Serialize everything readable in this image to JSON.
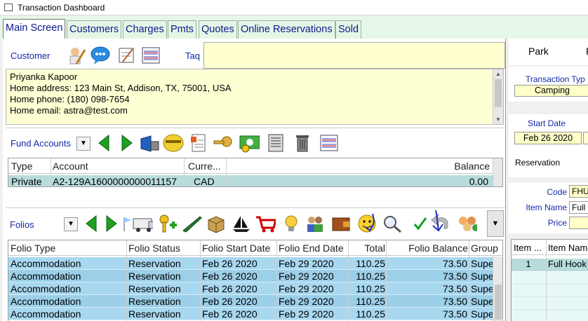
{
  "window": {
    "title": "Transaction Dashboard"
  },
  "tabs": [
    {
      "label": "Main Screen",
      "active": true
    },
    {
      "label": "Customers"
    },
    {
      "label": "Charges"
    },
    {
      "label": "Pmts"
    },
    {
      "label": "Quotes"
    },
    {
      "label": "Online Reservations"
    },
    {
      "label": "Sold"
    }
  ],
  "customer": {
    "label": "Customer",
    "tag_label": "Taq",
    "tag_value": "",
    "lines": [
      "Priyanka Kapoor",
      "Home address: 123 Main St, Addison, TX, 75001, USA",
      "Home phone: (180) 098-7654",
      "Home email: astra@test.com"
    ]
  },
  "fund_accounts": {
    "label": "Fund Accounts",
    "columns": [
      "Type",
      "Account",
      "Curre...",
      "Balance"
    ],
    "rows": [
      {
        "type": "Private",
        "account": "A2-129A1600000000011157",
        "currency": "CAD",
        "balance": "0.00"
      }
    ]
  },
  "folios": {
    "label": "Folios",
    "columns": [
      "Folio Type",
      "Folio Status",
      "Folio Start Date",
      "Folio End Date",
      "Total",
      "Folio Balance",
      "Group"
    ],
    "rows": [
      {
        "type": "Accommodation",
        "status": "Reservation",
        "start": "Feb 26 2020",
        "end": "Feb 29 2020",
        "total": "110.25",
        "balance": "73.50",
        "group": "Supe"
      },
      {
        "type": "Accommodation",
        "status": "Reservation",
        "start": "Feb 26 2020",
        "end": "Feb 29 2020",
        "total": "110.25",
        "balance": "73.50",
        "group": "Supe"
      },
      {
        "type": "Accommodation",
        "status": "Reservation",
        "start": "Feb 26 2020",
        "end": "Feb 29 2020",
        "total": "110.25",
        "balance": "73.50",
        "group": "Supe"
      },
      {
        "type": "Accommodation",
        "status": "Reservation",
        "start": "Feb 26 2020",
        "end": "Feb 29 2020",
        "total": "110.25",
        "balance": "73.50",
        "group": "Supe"
      },
      {
        "type": "Accommodation",
        "status": "Reservation",
        "start": "Feb 26 2020",
        "end": "Feb 29 2020",
        "total": "110.25",
        "balance": "73.50",
        "group": "Supe"
      }
    ]
  },
  "right": {
    "park_label": "Park",
    "park_extra": "F",
    "transaction_type_label": "Transaction Typ",
    "transaction_type_value": "Camping",
    "start_date_label": "Start Date",
    "start_date_value": "Feb 26 2020",
    "reservation_label": "Reservation",
    "code_label": "Code",
    "code_value": "FHU",
    "item_name_label": "Item Name",
    "item_name_value": "Full",
    "price_label": "Price",
    "price_value": "",
    "items_columns": [
      "Item ...",
      "Item Nam"
    ],
    "items_rows": [
      {
        "item": "1",
        "name": "Full Hook"
      }
    ]
  },
  "colors": {
    "accent_blue": "#1228a8",
    "row_selected": "#a8d8f0",
    "row_fund": "#b8dcdc",
    "yellow_field": "#ffffc8"
  }
}
